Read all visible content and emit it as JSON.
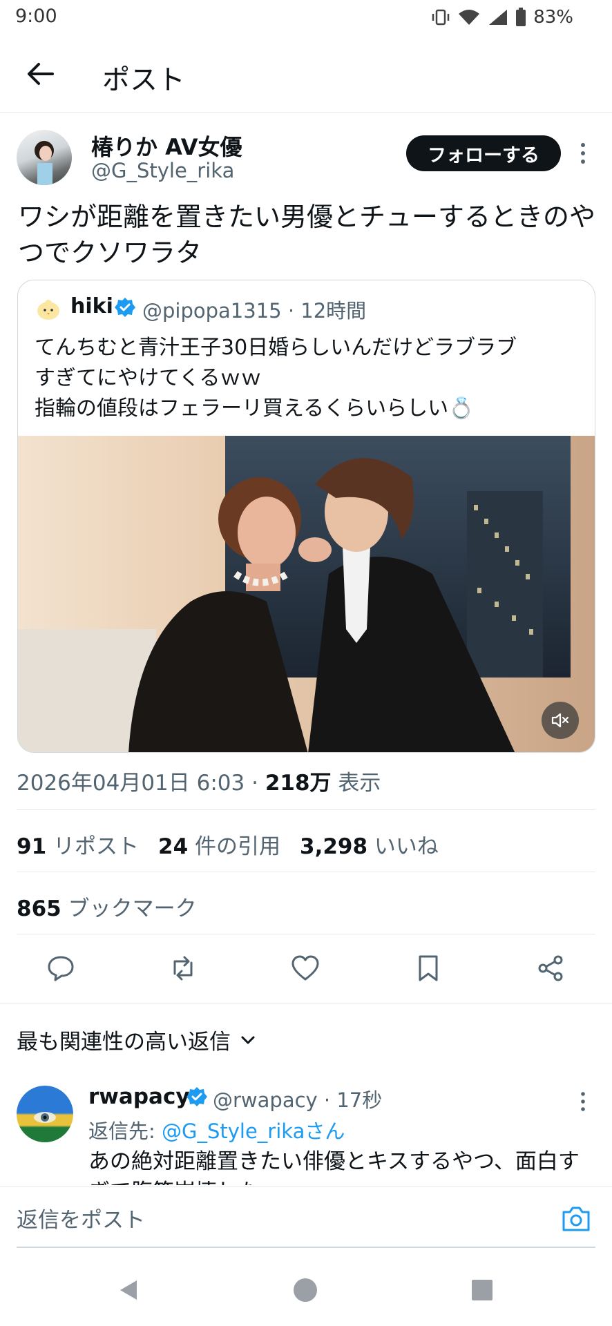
{
  "status_bar": {
    "time": "9:00",
    "battery": "83%"
  },
  "header": {
    "title": "ポスト"
  },
  "post": {
    "author_name": "椿りか AV女優",
    "author_handle": "@G_Style_rika",
    "follow_label": "フォローする",
    "text": "ワシが距離を置きたい男優とチューするときのやつでクソワラタ",
    "timestamp": "2026年04月01日 6:03 · ",
    "views_count": "218万",
    "views_label": " 表示",
    "reposts_count": "91",
    "reposts_label": " リポスト",
    "quotes_count": "24",
    "quotes_label": " 件の引用",
    "likes_count": "3,298",
    "likes_label": " いいね",
    "bookmarks_count": "865",
    "bookmarks_label": " ブックマーク"
  },
  "quoted": {
    "name": "hiki",
    "handle_time": "@pipopa1315 · 12時間",
    "text_line1": "てんちむと青汁王子30日婚らしいんだけどラブラブ",
    "text_line2": "すぎてにやけてくるｗｗ",
    "text_line3": "指輪の値段はフェラーリ買えるくらいらしい💍"
  },
  "replies_header": {
    "sort_label": "最も関連性の高い返信"
  },
  "reply": {
    "name": "rwapacy",
    "handle_time": "@rwapacy · 17秒",
    "reply_to_prefix": "返信先: ",
    "reply_to_handle": "@G_Style_rikaさん",
    "text": "あの絶対距離置きたい俳優とキスするやつ、面白すぎて腹筋崩壊した"
  },
  "compose": {
    "placeholder": "返信をポスト"
  },
  "colors": {
    "accent": "#1d9bf0",
    "text": "#0f1419",
    "secondary": "#536471"
  }
}
